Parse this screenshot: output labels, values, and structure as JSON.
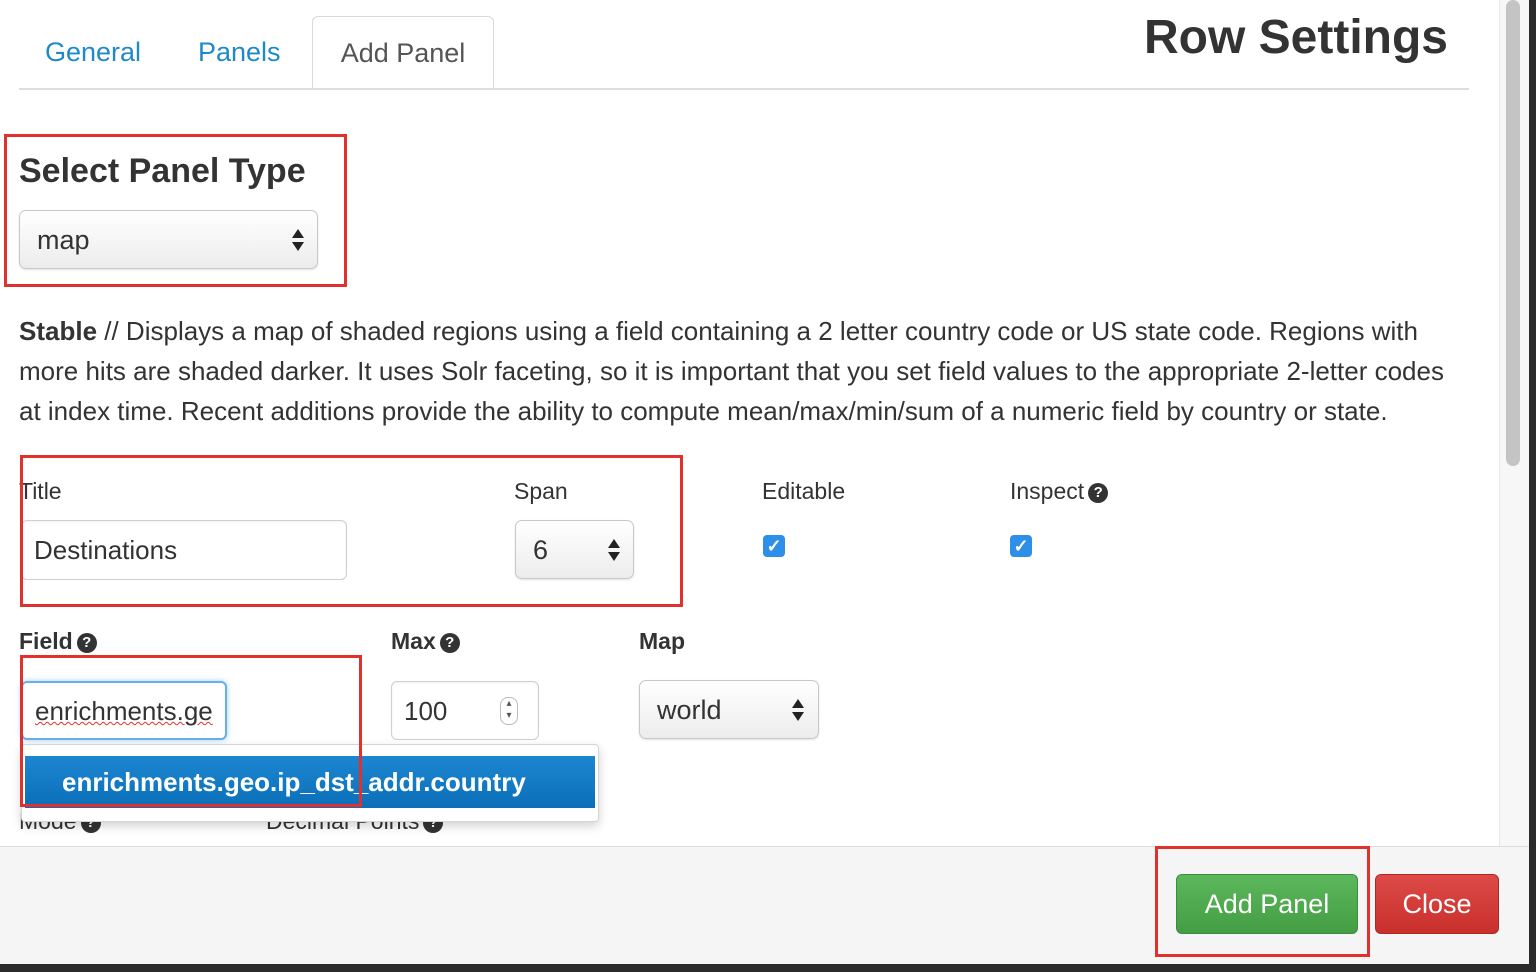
{
  "modal": {
    "title": "Row Settings"
  },
  "tabs": [
    {
      "label": "General",
      "active": false
    },
    {
      "label": "Panels",
      "active": false
    },
    {
      "label": "Add Panel",
      "active": true
    }
  ],
  "panel_type": {
    "heading": "Select Panel Type",
    "value": "map"
  },
  "description": {
    "stability": "Stable",
    "text": " // Displays a map of shaded regions using a field containing a 2 letter country code or US state code. Regions with more hits are shaded darker. It uses Solr faceting, so it is important that you set field values to the appropriate 2-letter codes at index time. Recent additions provide the ability to compute mean/max/min/sum of a numeric field by country or state."
  },
  "form": {
    "title_label": "Title",
    "title_value": "Destinations",
    "span_label": "Span",
    "span_value": "6",
    "editable_label": "Editable",
    "editable_checked": true,
    "inspect_label": "Inspect",
    "inspect_checked": true,
    "field_label": "Field",
    "field_value": "enrichments.ge",
    "max_label": "Max",
    "max_value": "100",
    "map_label": "Map",
    "map_value": "world",
    "mode_label": "Mode",
    "decimal_label": "Decimal Points"
  },
  "autocomplete": {
    "suggestion": "enrichments.geo.ip_dst_addr.country"
  },
  "footer": {
    "add_label": "Add Panel",
    "close_label": "Close"
  },
  "colors": {
    "accent": "#1f8ac9",
    "highlight_box": "#e0312c",
    "add_button": "#5cb85c",
    "close_button": "#d9534f",
    "checkbox": "#2e8fe8"
  }
}
